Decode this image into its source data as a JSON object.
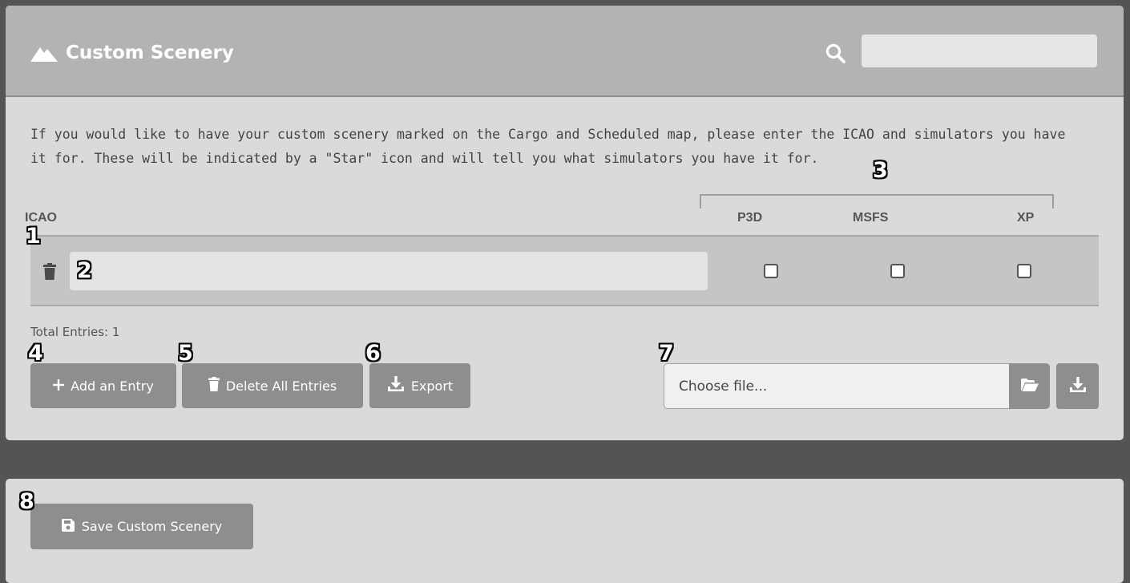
{
  "header": {
    "title": "Custom Scenery",
    "search": {
      "value": "",
      "placeholder": ""
    }
  },
  "description": "If you would like to have your custom scenery marked on the Cargo and Scheduled map, please enter the ICAO and simulators you have it for. These will be indicated by a \"Star\" icon and will tell you what simulators you have it for.",
  "table": {
    "columns": {
      "icao": "ICAO",
      "p3d": "P3D",
      "msfs": "MSFS",
      "xp": "XP"
    },
    "rows": [
      {
        "icao": "",
        "p3d": false,
        "msfs": false,
        "xp": false
      }
    ]
  },
  "total_entries": "Total Entries: 1",
  "buttons": {
    "add": "Add an Entry",
    "delete_all": "Delete All Entries",
    "export": "Export",
    "save": "Save Custom Scenery"
  },
  "file": {
    "placeholder": "Choose file..."
  },
  "callouts": [
    "1",
    "2",
    "3",
    "4",
    "5",
    "6",
    "7",
    "8"
  ],
  "icons": {
    "title": "mountain-icon",
    "search": "search-icon",
    "row_delete": "trash-icon",
    "add": "plus-icon",
    "delete_all": "trash-icon",
    "export": "download-icon",
    "browse": "folder-open-icon",
    "import": "download-icon",
    "save": "floppy-disk-icon"
  },
  "colors": {
    "background": "#545454",
    "panel": "#dadada",
    "header": "#b3b3b3",
    "button": "#8e8e8e",
    "row": "#c5c5c5"
  }
}
